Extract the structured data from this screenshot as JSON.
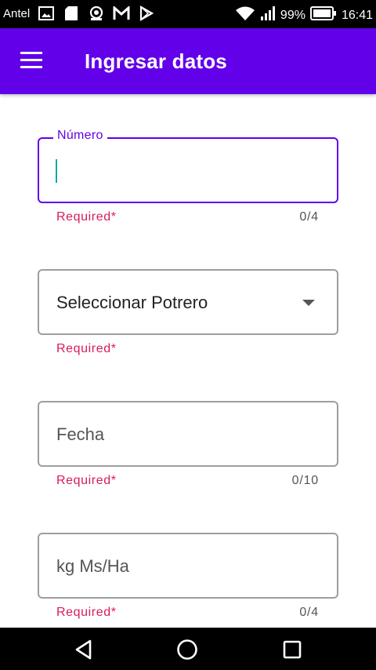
{
  "status_bar": {
    "carrier": "Antel",
    "battery": "99%",
    "time": "16:41",
    "icons": [
      "image-icon",
      "sd-card-icon",
      "radio-icon",
      "gmail-icon",
      "play-store-icon",
      "wifi-icon",
      "signal-icon",
      "battery-icon"
    ]
  },
  "app_bar": {
    "title": "Ingresar datos",
    "menu_icon": "hamburger-menu-icon",
    "background": "#6200ea"
  },
  "form": {
    "numero": {
      "label": "Número",
      "value": "",
      "helper": "Required*",
      "counter": "0/4"
    },
    "potrero": {
      "value": "Seleccionar Potrero",
      "helper": "Required*"
    },
    "fecha": {
      "placeholder": "Fecha",
      "helper": "Required*",
      "counter": "0/10"
    },
    "kg": {
      "placeholder": "kg Ms/Ha",
      "helper": "Required*",
      "counter": "0/4"
    }
  },
  "colors": {
    "accent": "#6200ea",
    "error": "#d81b60",
    "caret": "#13a6a1"
  },
  "nav_bar": {
    "icons": [
      "back-icon",
      "home-icon",
      "recents-icon"
    ]
  }
}
